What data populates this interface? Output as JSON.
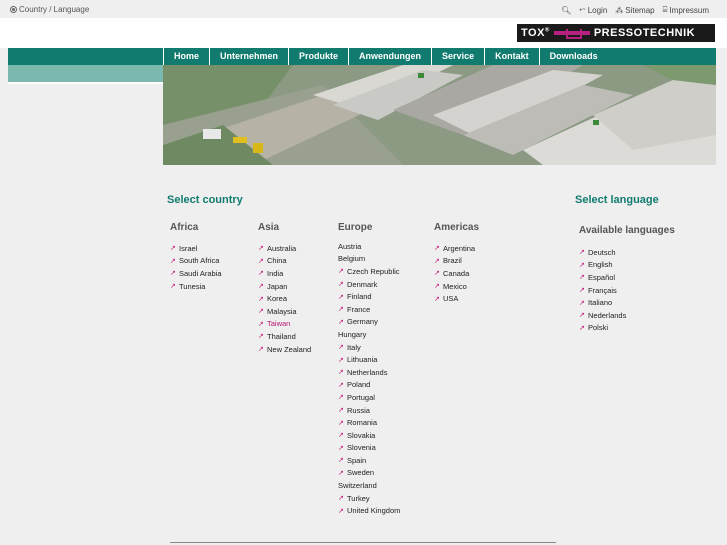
{
  "breadcrumb": {
    "label": "Country / Language"
  },
  "utility": {
    "login": "Login",
    "sitemap": "Sitemap",
    "impressum": "Impressum"
  },
  "logo": {
    "tox": "TOX",
    "reg": "®",
    "name": "PRESSOTECHNIK"
  },
  "nav": [
    "Home",
    "Unternehmen",
    "Produkte",
    "Anwendungen",
    "Service",
    "Kontakt",
    "Downloads"
  ],
  "country": {
    "title": "Select country",
    "regions": [
      {
        "name": "Africa",
        "items": [
          {
            "label": "Israel",
            "link": true
          },
          {
            "label": "South Africa",
            "link": true
          },
          {
            "label": "Saudi Arabia",
            "link": true
          },
          {
            "label": "Tunesia",
            "link": true
          }
        ]
      },
      {
        "name": "Asia",
        "items": [
          {
            "label": "Australia",
            "link": true
          },
          {
            "label": "China",
            "link": true
          },
          {
            "label": "India",
            "link": true
          },
          {
            "label": "Japan",
            "link": true
          },
          {
            "label": "Korea",
            "link": true
          },
          {
            "label": "Malaysia",
            "link": true
          },
          {
            "label": "Taiwan",
            "link": true,
            "highlight": true
          },
          {
            "label": "Thailand",
            "link": true
          },
          {
            "label": "New Zealand",
            "link": true
          }
        ]
      },
      {
        "name": "Europe",
        "items": [
          {
            "label": "Austria",
            "link": false
          },
          {
            "label": "Belgium",
            "link": false
          },
          {
            "label": "Czech Republic",
            "link": true
          },
          {
            "label": "Denmark",
            "link": true
          },
          {
            "label": "Finland",
            "link": true
          },
          {
            "label": "France",
            "link": true
          },
          {
            "label": "Germany",
            "link": true
          },
          {
            "label": "Hungary",
            "link": false
          },
          {
            "label": "Italy",
            "link": true
          },
          {
            "label": "Lithuania",
            "link": true
          },
          {
            "label": "Netherlands",
            "link": true
          },
          {
            "label": "Poland",
            "link": true
          },
          {
            "label": "Portugal",
            "link": true
          },
          {
            "label": "Russia",
            "link": true
          },
          {
            "label": "Romania",
            "link": true
          },
          {
            "label": "Slovakia",
            "link": true
          },
          {
            "label": "Slovenia",
            "link": true
          },
          {
            "label": "Spain",
            "link": true
          },
          {
            "label": "Sweden",
            "link": true
          },
          {
            "label": "Switzerland",
            "link": false
          },
          {
            "label": "Turkey",
            "link": true
          },
          {
            "label": "United Kingdom",
            "link": true
          }
        ]
      },
      {
        "name": "Americas",
        "items": [
          {
            "label": "Argentina",
            "link": true
          },
          {
            "label": "Brazil",
            "link": true
          },
          {
            "label": "Canada",
            "link": true
          },
          {
            "label": "Mexico",
            "link": true
          },
          {
            "label": "USA",
            "link": true
          }
        ]
      }
    ]
  },
  "language": {
    "title": "Select language",
    "subtitle": "Available languages",
    "items": [
      "Deutsch",
      "English",
      "Español",
      "Français",
      "Italiano",
      "Nederlands",
      "Polski"
    ]
  },
  "colors": {
    "brand": "#117b6f",
    "brand_light": "#7bb8ae",
    "link_arrow": "#c0157a",
    "logo_accent": "#b6207e"
  }
}
